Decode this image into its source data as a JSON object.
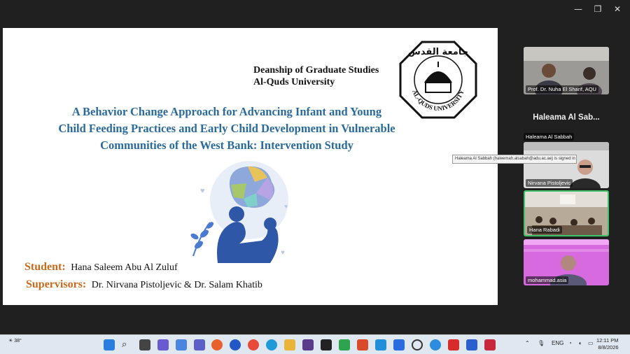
{
  "slide": {
    "dean_line1": "Deanship of Graduate Studies",
    "dean_line2": "Al-Quds University",
    "title_line1": "A Behavior Change Approach for Advancing Infant and Young",
    "title_line2": "Child Feeding Practices and Early Child Development in Vulnerable",
    "title_line3": "Communities of the West Bank: Intervention Study",
    "student_label": "Student:",
    "student_name": "Hana Saleem Abu Al Zuluf",
    "supervisors_label": "Supervisors:",
    "supervisors_names": "Dr. Nirvana Pistoljevic & Dr. Salam Khatib",
    "seal_text": "AL-QUDS UNIVERSITY",
    "seal_arabic": "جامعة القدس"
  },
  "participants": {
    "top_tile_label": "Prof. Dr. Nuha El Sharif, AQU",
    "speaker_name": "Haleama Al Sab...",
    "tiles": [
      {
        "label": "Haleama Al Sabbah"
      },
      {
        "label": "Nirvana Pistoljevic"
      },
      {
        "label": "Hana Rabadi"
      },
      {
        "label": "mohammad.asia"
      }
    ],
    "tooltip": "Haleama Al Sabbah (haleemah.alsabah@adu.ac.ae) is signed in"
  },
  "taskbar": {
    "weather": "38°",
    "language": "ENG",
    "time": "12:11 PM",
    "date": "8/8/2026"
  },
  "colors": {
    "title_blue": "#2a6a9a",
    "label_orange": "#c76a1c",
    "active_tile_border": "#3fc46a"
  }
}
